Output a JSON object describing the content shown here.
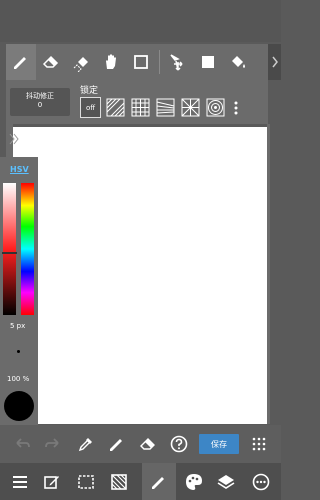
{
  "toolbar": {
    "tools": [
      "pen-icon",
      "eraser-icon",
      "lasso-eraser-icon",
      "hand-icon",
      "rect-select-icon",
      "move-icon",
      "fill-square-icon",
      "bucket-icon"
    ],
    "active_tool": "pen-icon"
  },
  "options": {
    "stabilizer_label": "抖动修正",
    "stabilizer_value": "0",
    "lock_label": "锁定",
    "ruler_off_label": "off",
    "rulers": [
      "off",
      "parallel",
      "grid",
      "perspective",
      "radial",
      "concentric"
    ]
  },
  "color_panel": {
    "mode_label": "HSV",
    "brush_size": "5 px",
    "opacity": "100 %",
    "current_color": "#000000",
    "sv_gradient_colors": [
      "#ffffff",
      "#ff2020",
      "#000000"
    ]
  },
  "action_bar": {
    "save_label": "保存",
    "save_color": "#3d86c6"
  },
  "bottom_bar": {
    "items": [
      "menu-icon",
      "edit-icon",
      "selection-icon",
      "transform-icon",
      "pen-icon",
      "palette-icon",
      "layers-icon",
      "settings-icon"
    ],
    "active_item": "pen-icon"
  }
}
